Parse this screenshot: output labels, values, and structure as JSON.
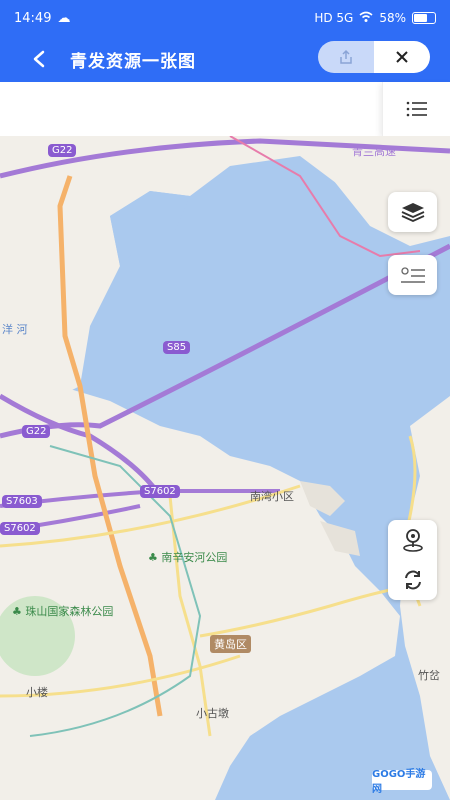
{
  "status": {
    "time": "14:49",
    "network": "HD 5G",
    "battery": "58%",
    "battery_level": 0.58
  },
  "header": {
    "title": "青发资源一张图",
    "back": "back-arrow-icon",
    "share": "share-icon",
    "close": "close-icon"
  },
  "toolbar": {
    "menu": "list-menu-icon"
  },
  "controls": [
    "layers-icon",
    "legend-icon",
    "location-pin-icon",
    "refresh-icon"
  ],
  "map": {
    "labels": [
      "南湾小区",
      "南辛安河公园",
      "珠山国家森林公园",
      "小楼",
      "小古墩",
      "竹岔"
    ],
    "district": "黄岛区",
    "roads": [
      "G22",
      "S85",
      "G22",
      "S7602",
      "S7603",
      "S7602",
      "青兰高速"
    ],
    "river_text": "洋 河"
  },
  "watermark": "GOGO手游网"
}
